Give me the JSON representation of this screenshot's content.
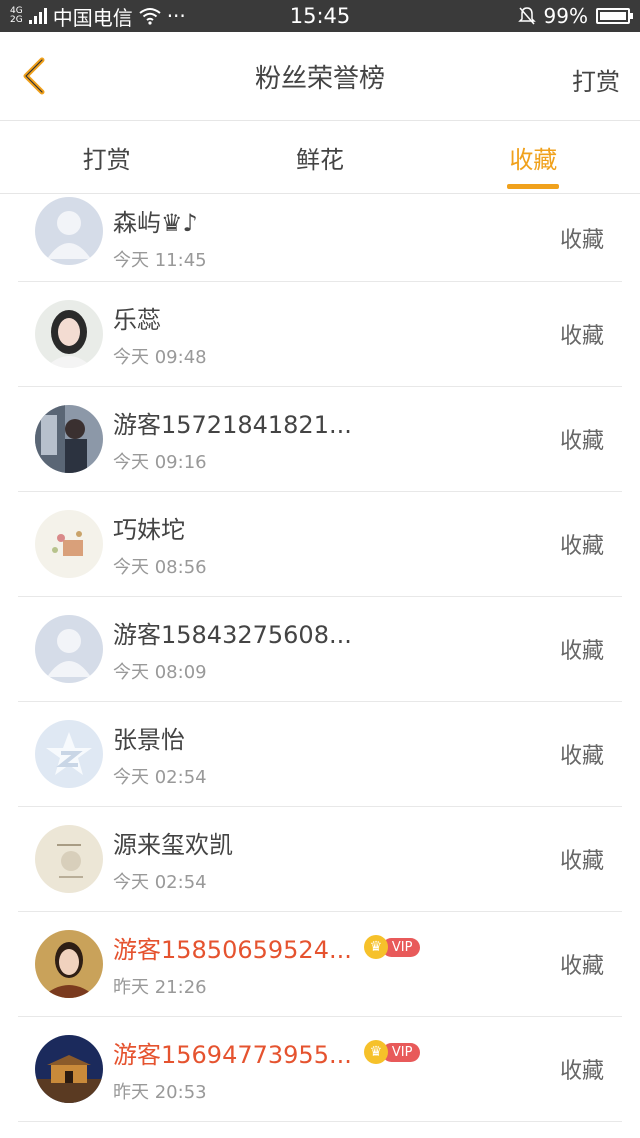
{
  "status": {
    "net": [
      "4G",
      "2G"
    ],
    "carrier": "中国电信",
    "dots": "···",
    "time": "15:45",
    "battery": "99%",
    "battery_level": 0.99
  },
  "header": {
    "title": "粉丝荣誉榜",
    "right_action": "打赏"
  },
  "tabs": [
    {
      "label": "打赏",
      "active": false
    },
    {
      "label": "鲜花",
      "active": false
    },
    {
      "label": "收藏",
      "active": true
    }
  ],
  "accent_color": "#f0a11c",
  "vip_color": "#e5532f",
  "items": [
    {
      "name": "森屿♛♪",
      "time": "今天 11:45",
      "action": "收藏",
      "vip": false,
      "avatar": "default-person"
    },
    {
      "name": "乐蕊",
      "time": "今天 09:48",
      "action": "收藏",
      "vip": false,
      "avatar": "girl-photo"
    },
    {
      "name": "游客15721841821...",
      "time": "今天 09:16",
      "action": "收藏",
      "vip": false,
      "avatar": "boy-photo"
    },
    {
      "name": "巧妹坨",
      "time": "今天 08:56",
      "action": "收藏",
      "vip": false,
      "avatar": "cartoon-photo"
    },
    {
      "name": "游客15843275608...",
      "time": "今天 08:09",
      "action": "收藏",
      "vip": false,
      "avatar": "default-person"
    },
    {
      "name": "张景怡",
      "time": "今天 02:54",
      "action": "收藏",
      "vip": false,
      "avatar": "qzone-icon"
    },
    {
      "name": "源来玺欢凯",
      "time": "今天 02:54",
      "action": "收藏",
      "vip": false,
      "avatar": "sketch-photo"
    },
    {
      "name": "游客15850659524...",
      "time": "昨天 21:26",
      "action": "收藏",
      "vip": true,
      "vip_label": "VIP",
      "avatar": "woman-photo"
    },
    {
      "name": "游客15694773955...",
      "time": "昨天 20:53",
      "action": "收藏",
      "vip": true,
      "vip_label": "VIP",
      "avatar": "night-gate-photo"
    }
  ]
}
